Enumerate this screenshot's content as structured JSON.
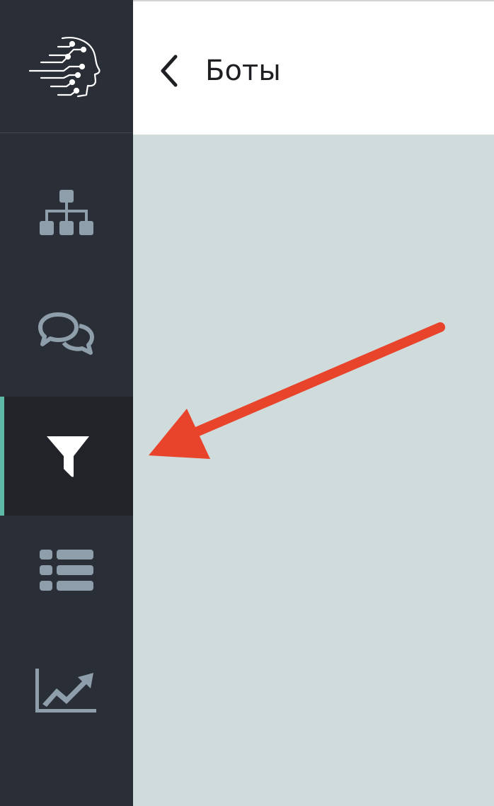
{
  "header": {
    "title": "Боты",
    "back_icon": "chevron-left-icon"
  },
  "sidebar": {
    "logo_icon": "ai-head-circuit-logo",
    "items": [
      {
        "id": "structure",
        "icon": "sitemap-icon",
        "active": false
      },
      {
        "id": "dialogs",
        "icon": "chat-bubbles-icon",
        "active": false
      },
      {
        "id": "filters",
        "icon": "funnel-icon",
        "active": true
      },
      {
        "id": "lists",
        "icon": "list-icon",
        "active": false
      },
      {
        "id": "analytics",
        "icon": "trend-chart-icon",
        "active": false
      }
    ]
  },
  "annotation": {
    "icon": "red-arrow-pointing-at-funnel",
    "color": "#e8432b"
  },
  "colors": {
    "sidebar_bg": "#2a2e37",
    "sidebar_active_bg": "#212329",
    "active_indicator": "#5fb9a7",
    "icon_muted": "#8e9eaa",
    "icon_active": "#ffffff",
    "content_bg": "#d0dcdc",
    "topbar_bg": "#ffffff"
  }
}
